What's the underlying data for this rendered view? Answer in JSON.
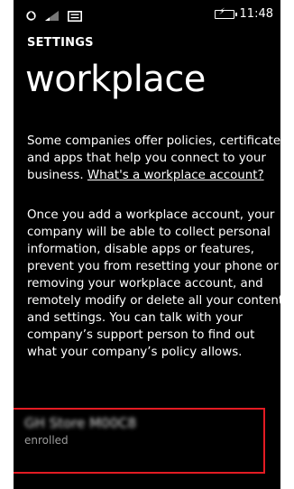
{
  "status_bar": {
    "time": "11:48",
    "icons": [
      "sync-icon",
      "signal-icon",
      "message-icon",
      "battery-charging-icon"
    ]
  },
  "header": {
    "section": "SETTINGS",
    "title": "workplace"
  },
  "intro": {
    "lines": [
      "Some companies offer policies, certificates,",
      "and apps that help you connect to your",
      "business."
    ],
    "link_text": "What's a workplace account?"
  },
  "description": {
    "lines": [
      "Once you add a workplace account, your",
      "company will be able to collect personal",
      "information, disable apps or features,",
      "prevent you from resetting your phone or",
      "removing your workplace account, and",
      "remotely modify or delete all your content",
      "and settings. You can talk with your",
      "company’s support person to find out",
      "what your company’s policy allows."
    ]
  },
  "account": {
    "name": "GH Store M00C8",
    "status": "enrolled",
    "highlight_color": "#e31b23"
  }
}
